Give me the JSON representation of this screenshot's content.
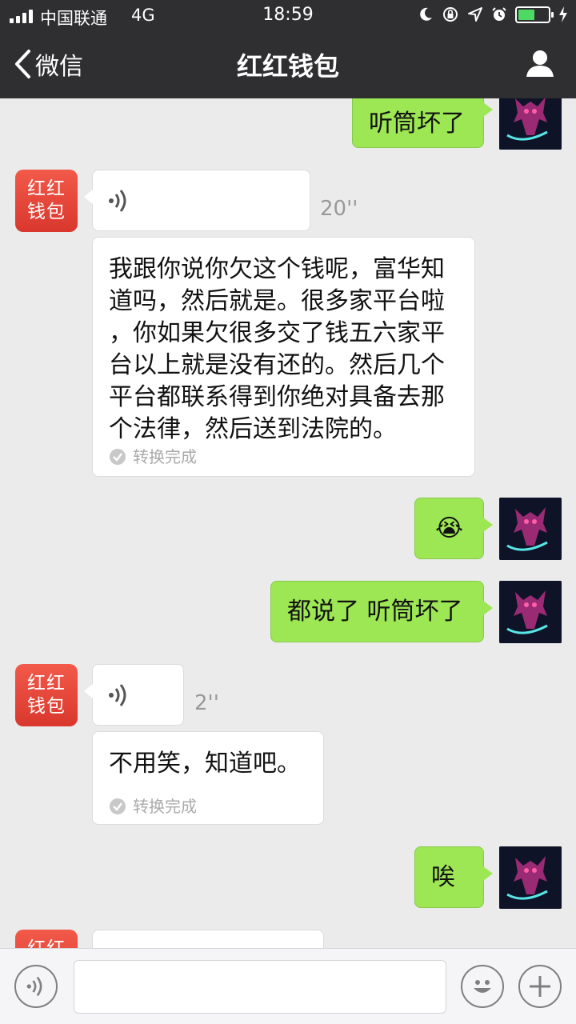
{
  "status_bar": {
    "carrier": "中国联通",
    "network": "4G",
    "time": "18:59",
    "icons": [
      "moon-icon",
      "orientation-lock-icon",
      "location-icon",
      "alarm-icon",
      "battery-icon",
      "charging-icon"
    ],
    "battery_level": 0.55,
    "signal_bars": 4
  },
  "nav": {
    "back_label": "微信",
    "title": "红红钱包",
    "profile_icon": "person-icon"
  },
  "brand_avatar": {
    "line1": "红红",
    "line2": "钱包",
    "color": "#e4463a"
  },
  "messages": [
    {
      "side": "right",
      "type": "text",
      "text": "听筒坏了"
    },
    {
      "side": "left",
      "type": "voice",
      "duration": "20''"
    },
    {
      "side": "left",
      "type": "transcript",
      "text": "我跟你说你欠这个钱呢，富华知\n道吗，然后就是。很多家平台啦\n，你如果欠很多交了钱五六家平\n台以上就是没有还的。然后几个\n平台都联系得到你绝对具备去那\n个法律，然后送到法院的。",
      "status": "转换完成"
    },
    {
      "side": "right",
      "type": "emoji",
      "emoji": "😭"
    },
    {
      "side": "right",
      "type": "text",
      "text": "都说了 听筒坏了"
    },
    {
      "side": "left",
      "type": "voice",
      "duration": "2''"
    },
    {
      "side": "left",
      "type": "transcript",
      "text": "不用笑，知道吧。",
      "status": "转换完成"
    },
    {
      "side": "right",
      "type": "text",
      "text": "唉"
    }
  ],
  "input_bar": {
    "voice_icon": "voice-input-icon",
    "emoji_icon": "emoji-icon",
    "plus_icon": "plus-icon",
    "placeholder": ""
  },
  "colors": {
    "header_bg": "#2f2f31",
    "chat_bg": "#ebebeb",
    "bubble_green": "#9de754",
    "bubble_white": "#ffffff",
    "battery_green": "#4cd964"
  }
}
